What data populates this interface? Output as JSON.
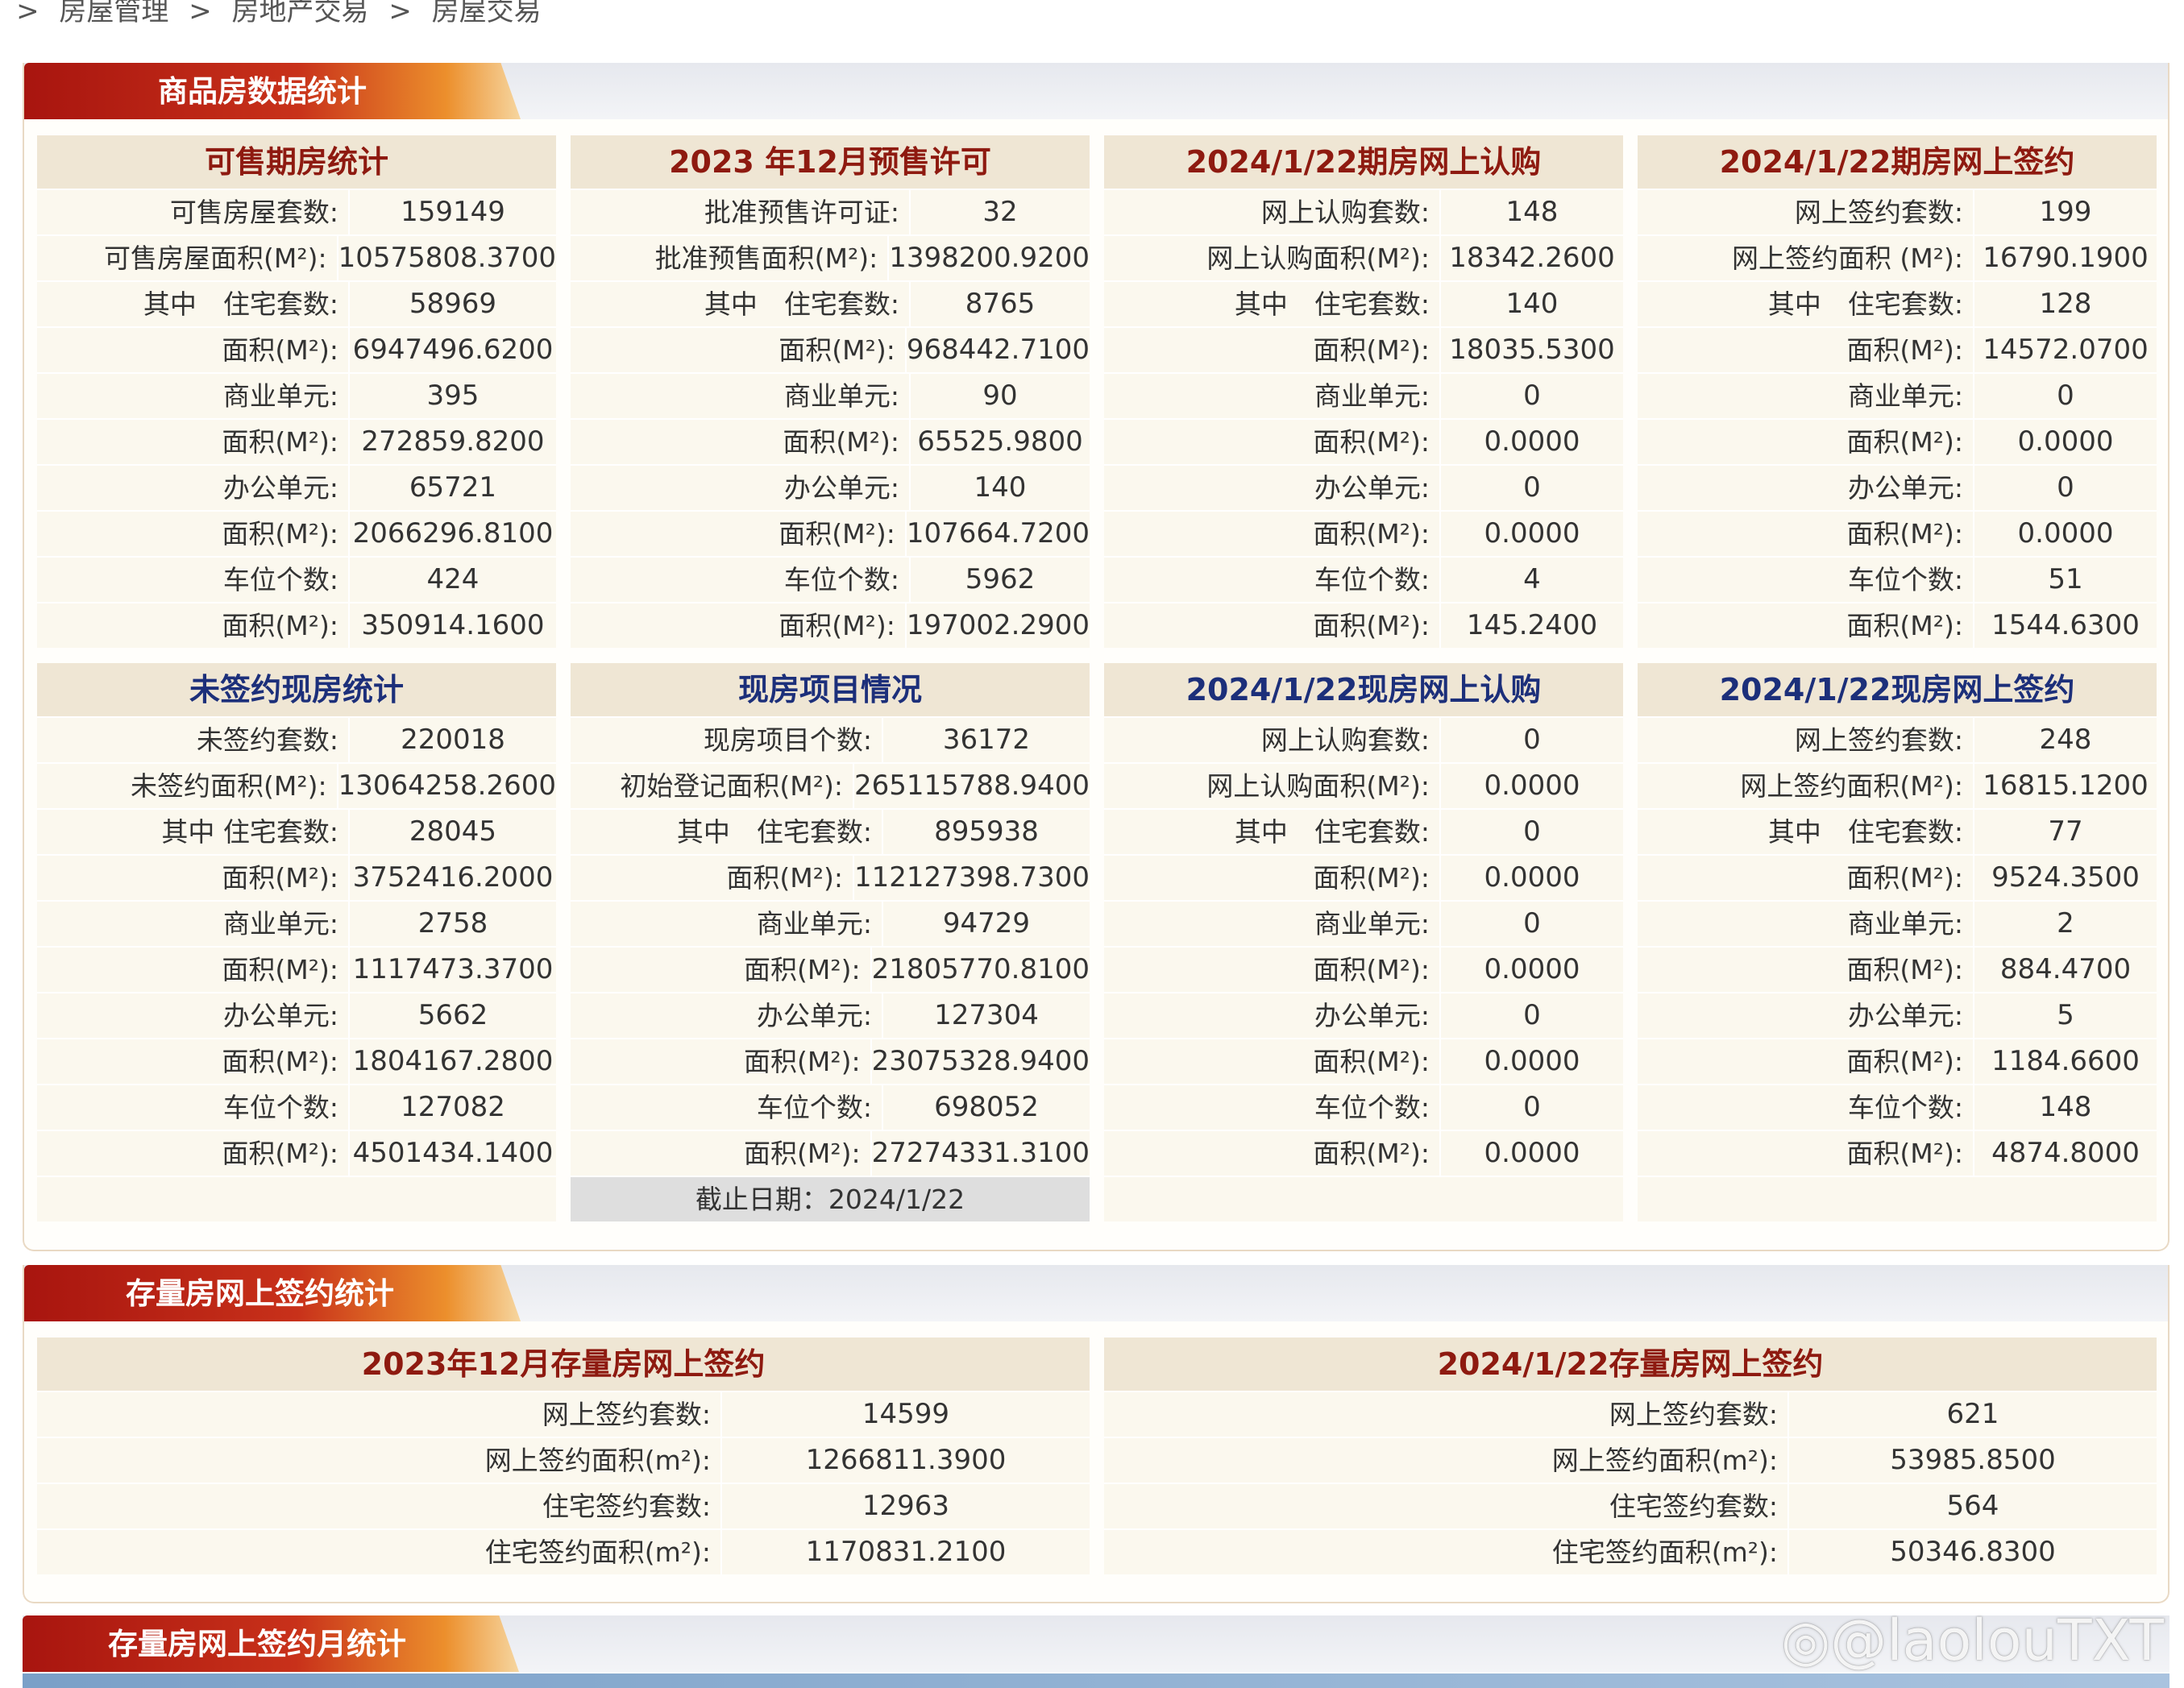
{
  "breadcrumb": [
    "]",
    ">",
    "房屋管理",
    ">",
    "房地产交易",
    ">",
    "房屋交易"
  ],
  "sections": {
    "new_housing": {
      "title": "商品房数据统计",
      "blocks": [
        {
          "title": "可售期房统计",
          "rows": [
            {
              "label": "可售房屋套数:",
              "value": "159149"
            },
            {
              "label": "可售房屋面积(M²):",
              "value": "10575808.3700"
            },
            {
              "label": "其中　住宅套数:",
              "value": "58969"
            },
            {
              "label": "面积(M²):",
              "value": "6947496.6200"
            },
            {
              "label": "商业单元:",
              "value": "395"
            },
            {
              "label": "面积(M²):",
              "value": "272859.8200"
            },
            {
              "label": "办公单元:",
              "value": "65721"
            },
            {
              "label": "面积(M²):",
              "value": "2066296.8100"
            },
            {
              "label": "车位个数:",
              "value": "424"
            },
            {
              "label": "面积(M²):",
              "value": "350914.1600"
            }
          ]
        },
        {
          "title": "2023 年12月预售许可",
          "rows": [
            {
              "label": "批准预售许可证:",
              "value": "32"
            },
            {
              "label": "批准预售面积(M²):",
              "value": "1398200.9200"
            },
            {
              "label": "其中　住宅套数:",
              "value": "8765"
            },
            {
              "label": "面积(M²):",
              "value": "968442.7100"
            },
            {
              "label": "商业单元:",
              "value": "90"
            },
            {
              "label": "面积(M²):",
              "value": "65525.9800"
            },
            {
              "label": "办公单元:",
              "value": "140"
            },
            {
              "label": "面积(M²):",
              "value": "107664.7200"
            },
            {
              "label": "车位个数:",
              "value": "5962"
            },
            {
              "label": "面积(M²):",
              "value": "197002.2900"
            }
          ]
        },
        {
          "title": "2024/1/22期房网上认购",
          "rows": [
            {
              "label": "网上认购套数:",
              "value": "148"
            },
            {
              "label": "网上认购面积(M²):",
              "value": "18342.2600"
            },
            {
              "label": "其中　住宅套数:",
              "value": "140"
            },
            {
              "label": "面积(M²):",
              "value": "18035.5300"
            },
            {
              "label": "商业单元:",
              "value": "0"
            },
            {
              "label": "面积(M²):",
              "value": "0.0000"
            },
            {
              "label": "办公单元:",
              "value": "0"
            },
            {
              "label": "面积(M²):",
              "value": "0.0000"
            },
            {
              "label": "车位个数:",
              "value": "4"
            },
            {
              "label": "面积(M²):",
              "value": "145.2400"
            }
          ]
        },
        {
          "title": "2024/1/22期房网上签约",
          "rows": [
            {
              "label": "网上签约套数:",
              "value": "199"
            },
            {
              "label": "网上签约面积 (M²):",
              "value": "16790.1900"
            },
            {
              "label": "其中　住宅套数:",
              "value": "128"
            },
            {
              "label": "面积(M²):",
              "value": "14572.0700"
            },
            {
              "label": "商业单元:",
              "value": "0"
            },
            {
              "label": "面积(M²):",
              "value": "0.0000"
            },
            {
              "label": "办公单元:",
              "value": "0"
            },
            {
              "label": "面积(M²):",
              "value": "0.0000"
            },
            {
              "label": "车位个数:",
              "value": "51"
            },
            {
              "label": "面积(M²):",
              "value": "1544.6300"
            }
          ]
        },
        {
          "title": "未签约现房统计",
          "rows": [
            {
              "label": "未签约套数:",
              "value": "220018"
            },
            {
              "label": "未签约面积(M²):",
              "value": "13064258.2600"
            },
            {
              "label": "其中 住宅套数:",
              "value": "28045"
            },
            {
              "label": "面积(M²):",
              "value": "3752416.2000"
            },
            {
              "label": "商业单元:",
              "value": "2758"
            },
            {
              "label": "面积(M²):",
              "value": "1117473.3700"
            },
            {
              "label": "办公单元:",
              "value": "5662"
            },
            {
              "label": "面积(M²):",
              "value": "1804167.2800"
            },
            {
              "label": "车位个数:",
              "value": "127082"
            },
            {
              "label": "面积(M²):",
              "value": "4501434.1400"
            }
          ]
        },
        {
          "title": "现房项目情况",
          "rows": [
            {
              "label": "现房项目个数:",
              "value": "36172"
            },
            {
              "label": "初始登记面积(M²):",
              "value": "265115788.9400"
            },
            {
              "label": "其中　住宅套数:",
              "value": "895938"
            },
            {
              "label": "面积(M²):",
              "value": "112127398.7300"
            },
            {
              "label": "商业单元:",
              "value": "94729"
            },
            {
              "label": "面积(M²):",
              "value": "21805770.8100"
            },
            {
              "label": "办公单元:",
              "value": "127304"
            },
            {
              "label": "面积(M²):",
              "value": "23075328.9400"
            },
            {
              "label": "车位个数:",
              "value": "698052"
            },
            {
              "label": "面积(M²):",
              "value": "27274331.3100"
            }
          ],
          "footer": "截止日期：2024/1/22"
        },
        {
          "title": "2024/1/22现房网上认购",
          "rows": [
            {
              "label": "网上认购套数:",
              "value": "0"
            },
            {
              "label": "网上认购面积(M²):",
              "value": "0.0000"
            },
            {
              "label": "其中　住宅套数:",
              "value": "0"
            },
            {
              "label": "面积(M²):",
              "value": "0.0000"
            },
            {
              "label": "商业单元:",
              "value": "0"
            },
            {
              "label": "面积(M²):",
              "value": "0.0000"
            },
            {
              "label": "办公单元:",
              "value": "0"
            },
            {
              "label": "面积(M²):",
              "value": "0.0000"
            },
            {
              "label": "车位个数:",
              "value": "0"
            },
            {
              "label": "面积(M²):",
              "value": "0.0000"
            }
          ]
        },
        {
          "title": "2024/1/22现房网上签约",
          "rows": [
            {
              "label": "网上签约套数:",
              "value": "248"
            },
            {
              "label": "网上签约面积(M²):",
              "value": "16815.1200"
            },
            {
              "label": "其中　住宅套数:",
              "value": "77"
            },
            {
              "label": "面积(M²):",
              "value": "9524.3500"
            },
            {
              "label": "商业单元:",
              "value": "2"
            },
            {
              "label": "面积(M²):",
              "value": "884.4700"
            },
            {
              "label": "办公单元:",
              "value": "5"
            },
            {
              "label": "面积(M²):",
              "value": "1184.6600"
            },
            {
              "label": "车位个数:",
              "value": "148"
            },
            {
              "label": "面积(M²):",
              "value": "4874.8000"
            }
          ]
        }
      ]
    },
    "resale": {
      "title": "存量房网上签约统计",
      "blocks": [
        {
          "title": "2023年12月存量房网上签约",
          "rows": [
            {
              "label": "网上签约套数:",
              "value": "14599"
            },
            {
              "label": "网上签约面积(m²):",
              "value": "1266811.3900"
            },
            {
              "label": "住宅签约套数:",
              "value": "12963"
            },
            {
              "label": "住宅签约面积(m²):",
              "value": "1170831.2100"
            }
          ]
        },
        {
          "title": "2024/1/22存量房网上签约",
          "rows": [
            {
              "label": "网上签约套数:",
              "value": "621"
            },
            {
              "label": "网上签约面积(m²):",
              "value": "53985.8500"
            },
            {
              "label": "住宅签约套数:",
              "value": "564"
            },
            {
              "label": "住宅签约面积(m²):",
              "value": "50346.8300"
            }
          ]
        }
      ]
    },
    "monthly": {
      "title": "存量房网上签约月统计"
    }
  },
  "watermark": "@laolouTXT",
  "colors": {
    "title_red": "#8e1a10",
    "title_blue": "#1c2f7a",
    "header_band": "#efe6d4",
    "row_bg": "#fbf8ee"
  },
  "icons": {
    "watermark_logo": "weibo-logo-icon"
  }
}
